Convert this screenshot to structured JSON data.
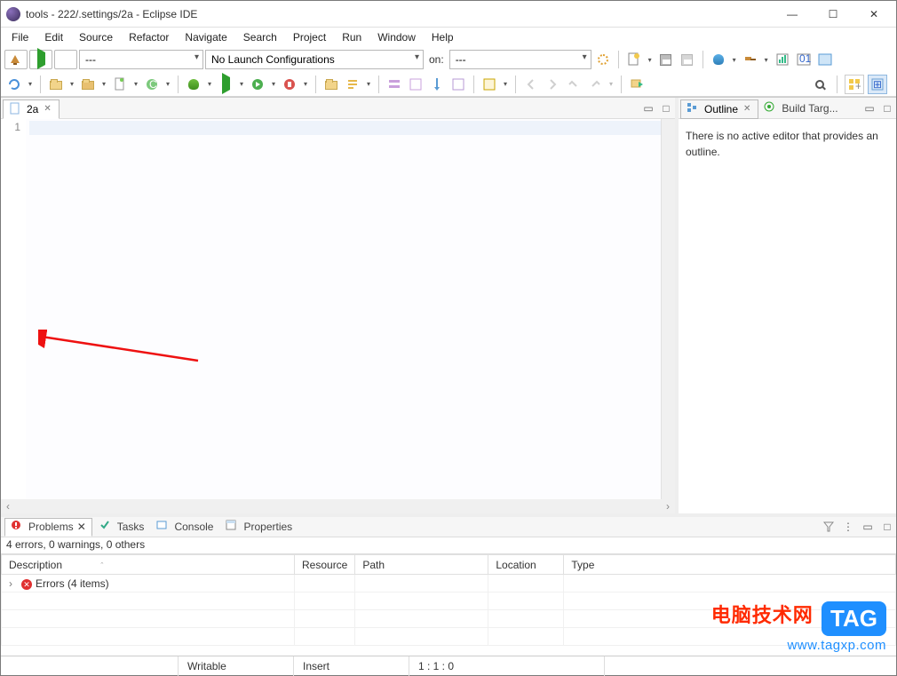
{
  "window": {
    "title": "tools - 222/.settings/2a - Eclipse IDE"
  },
  "menu": [
    "File",
    "Edit",
    "Source",
    "Refactor",
    "Navigate",
    "Search",
    "Project",
    "Run",
    "Window",
    "Help"
  ],
  "toolbar1": {
    "run_config_combo": "---",
    "launch_combo": "No Launch Configurations",
    "on_label": "on:",
    "target_combo": "---"
  },
  "editor": {
    "tab_label": "2a",
    "line_numbers": [
      "1"
    ]
  },
  "outline": {
    "tab_label": "Outline",
    "build_tab_label": "Build Targ...",
    "empty_msg": "There is no active editor that provides an outline."
  },
  "bottom": {
    "tabs": {
      "problems": "Problems",
      "tasks": "Tasks",
      "console": "Console",
      "properties": "Properties"
    },
    "summary": "4 errors, 0 warnings, 0 others",
    "columns": [
      "Description",
      "Resource",
      "Path",
      "Location",
      "Type"
    ],
    "row_errors": "Errors (4 items)"
  },
  "status": {
    "writable": "Writable",
    "insert": "Insert",
    "cursor": "1 : 1 : 0"
  },
  "watermark": {
    "cn": "电脑技术网",
    "tag": "TAG",
    "url": "www.tagxp.com"
  }
}
